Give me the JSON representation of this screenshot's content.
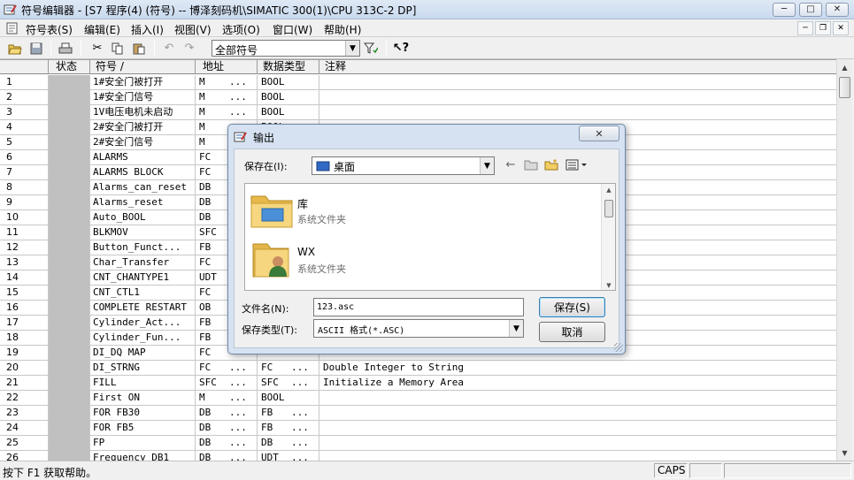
{
  "window": {
    "title": "符号编辑器 - [S7 程序(4) (符号) -- 博泽刻码机\\SIMATIC 300(1)\\CPU 313C-2 DP]",
    "controls": [
      "minimize-icon",
      "maximize-icon",
      "close-icon"
    ]
  },
  "menu": {
    "items": [
      "符号表(S)",
      "编辑(E)",
      "插入(I)",
      "视图(V)",
      "选项(O)",
      "窗口(W)",
      "帮助(H)"
    ]
  },
  "toolbar": {
    "icons": [
      "open-icon",
      "save-icon",
      "print-icon",
      "cut-icon",
      "copy-icon",
      "paste-icon",
      "undo-icon",
      "redo-icon",
      "filter-icon",
      "help-cursor-icon"
    ],
    "filter_value": "全部符号"
  },
  "table": {
    "headers": [
      "状态",
      "符号 /",
      "地址",
      "数据类型",
      "注释"
    ],
    "rows": [
      {
        "no": "1",
        "symbol": "1#安全门被打开",
        "addr": "M",
        "addr_more": "...",
        "type": "BOOL",
        "type_more": "",
        "comment": ""
      },
      {
        "no": "2",
        "symbol": "1#安全门信号",
        "addr": "M",
        "addr_more": "...",
        "type": "BOOL",
        "type_more": "",
        "comment": ""
      },
      {
        "no": "3",
        "symbol": "1V电压电机未启动",
        "addr": "M",
        "addr_more": "...",
        "type": "BOOL",
        "type_more": "",
        "comment": ""
      },
      {
        "no": "4",
        "symbol": "2#安全门被打开",
        "addr": "M",
        "addr_more": "...",
        "type": "BOOL",
        "type_more": "",
        "comment": ""
      },
      {
        "no": "5",
        "symbol": "2#安全门信号",
        "addr": "M",
        "addr_more": "",
        "type": "",
        "type_more": "",
        "comment": ""
      },
      {
        "no": "6",
        "symbol": "ALARMS",
        "addr": "FC",
        "addr_more": "",
        "type": "",
        "type_more": "",
        "comment": ""
      },
      {
        "no": "7",
        "symbol": "ALARMS BLOCK",
        "addr": "FC",
        "addr_more": "",
        "type": "",
        "type_more": "",
        "comment": ""
      },
      {
        "no": "8",
        "symbol": "Alarms_can_reset",
        "addr": "DB",
        "addr_more": "",
        "type": "",
        "type_more": "",
        "comment": ""
      },
      {
        "no": "9",
        "symbol": "Alarms_reset",
        "addr": "DB",
        "addr_more": "",
        "type": "",
        "type_more": "",
        "comment": ""
      },
      {
        "no": "10",
        "symbol": "Auto_BOOL",
        "addr": "DB",
        "addr_more": "",
        "type": "",
        "type_more": "",
        "comment": ""
      },
      {
        "no": "11",
        "symbol": "BLKMOV",
        "addr": "SFC",
        "addr_more": "",
        "type": "",
        "type_more": "",
        "comment": ""
      },
      {
        "no": "12",
        "symbol": "Button_Funct...",
        "addr": "FB",
        "addr_more": "",
        "type": "",
        "type_more": "",
        "comment": ""
      },
      {
        "no": "13",
        "symbol": "Char_Transfer",
        "addr": "FC",
        "addr_more": "",
        "type": "",
        "type_more": "",
        "comment": ""
      },
      {
        "no": "14",
        "symbol": "CNT_CHANTYPE1",
        "addr": "UDT",
        "addr_more": "",
        "type": "",
        "type_more": "",
        "comment": ""
      },
      {
        "no": "15",
        "symbol": "CNT_CTL1",
        "addr": "FC",
        "addr_more": "",
        "type": "",
        "type_more": "",
        "comment": "sochrone mode)"
      },
      {
        "no": "16",
        "symbol": "COMPLETE RESTART",
        "addr": "OB",
        "addr_more": "",
        "type": "",
        "type_more": "",
        "comment": ""
      },
      {
        "no": "17",
        "symbol": "Cylinder_Act...",
        "addr": "FB",
        "addr_more": "",
        "type": "",
        "type_more": "",
        "comment": ""
      },
      {
        "no": "18",
        "symbol": "Cylinder_Fun...",
        "addr": "FB",
        "addr_more": "",
        "type": "",
        "type_more": "",
        "comment": ""
      },
      {
        "no": "19",
        "symbol": "DI_DQ MAP",
        "addr": "FC",
        "addr_more": "",
        "type": "",
        "type_more": "",
        "comment": ""
      },
      {
        "no": "20",
        "symbol": "DI_STRNG",
        "addr": "FC",
        "addr_more": "...",
        "type": "FC",
        "type_more": "...",
        "comment": "Double Integer to String"
      },
      {
        "no": "21",
        "symbol": "FILL",
        "addr": "SFC",
        "addr_more": "...",
        "type": "SFC",
        "type_more": "...",
        "comment": "Initialize a Memory Area"
      },
      {
        "no": "22",
        "symbol": "First ON",
        "addr": "M",
        "addr_more": "...",
        "type": "BOOL",
        "type_more": "",
        "comment": ""
      },
      {
        "no": "23",
        "symbol": "FOR FB30",
        "addr": "DB",
        "addr_more": "...",
        "type": "FB",
        "type_more": "...",
        "comment": ""
      },
      {
        "no": "24",
        "symbol": "FOR FB5",
        "addr": "DB",
        "addr_more": "...",
        "type": "FB",
        "type_more": "...",
        "comment": ""
      },
      {
        "no": "25",
        "symbol": "FP",
        "addr": "DB",
        "addr_more": "...",
        "type": "DB",
        "type_more": "...",
        "comment": ""
      },
      {
        "no": "26",
        "symbol": "Frequency DB1",
        "addr": "DB",
        "addr_more": "...",
        "type": "UDT",
        "type_more": "...",
        "comment": ""
      }
    ]
  },
  "statusbar": {
    "message": "按下 F1 获取帮助。",
    "caps": "CAPS"
  },
  "dialog": {
    "title": "输出",
    "save_in_label": "保存在(I):",
    "save_in_value": "桌面",
    "files": [
      {
        "name": "库",
        "desc": "系统文件夹",
        "icon": "library-folder-icon"
      },
      {
        "name": "WX",
        "desc": "系统文件夹",
        "icon": "user-folder-icon"
      }
    ],
    "filename_label": "文件名(N):",
    "filename_value": "123.asc",
    "filetype_label": "保存类型(T):",
    "filetype_value": "ASCII 格式(*.ASC)",
    "save_button": "保存(S)",
    "cancel_button": "取消"
  }
}
